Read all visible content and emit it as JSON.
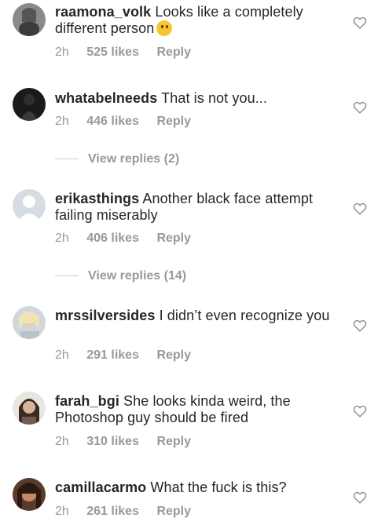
{
  "comments": [
    {
      "username": "raamona_volk",
      "text": "Looks like a completely different person",
      "emoji": "thinking-face",
      "time": "2h",
      "likes": "525 likes",
      "reply": "Reply"
    },
    {
      "username": "whatabelneeds",
      "text": "That is not you...",
      "time": "2h",
      "likes": "446 likes",
      "reply": "Reply"
    },
    {
      "username": "erikasthings",
      "text": "Another black face attempt failing miserably",
      "time": "2h",
      "likes": "406 likes",
      "reply": "Reply"
    },
    {
      "username": "mrssilversides",
      "text": "I didn’t even recognize you",
      "time": "2h",
      "likes": "291 likes",
      "reply": "Reply"
    },
    {
      "username": "farah_bgi",
      "text": "She looks kinda weird, the Photoshop guy should be fired",
      "time": "2h",
      "likes": "310 likes",
      "reply": "Reply"
    },
    {
      "username": "camillacarmo",
      "text": "What the fuck is this?",
      "time": "2h",
      "likes": "261 likes",
      "reply": "Reply"
    }
  ],
  "view_replies": [
    {
      "label": "View replies (2)"
    },
    {
      "label": "View replies (14)"
    }
  ],
  "colors": {
    "text": "#262626",
    "meta": "#999999",
    "heart_outline": "#8e8e8e"
  }
}
